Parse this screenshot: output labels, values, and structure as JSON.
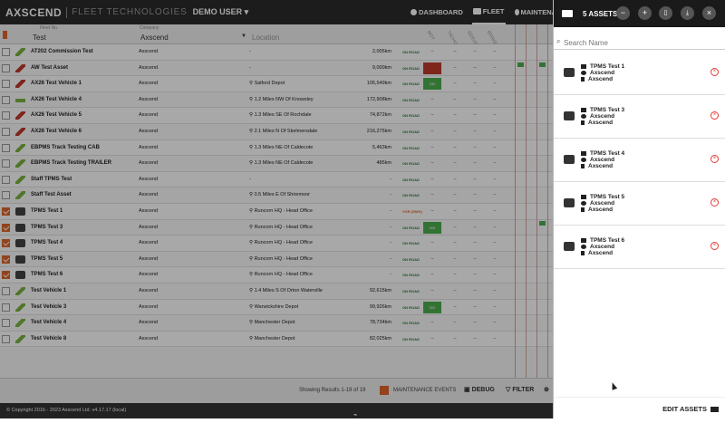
{
  "brand": {
    "logo": "AXSCEND",
    "sub": "FLEET TECHNOLOGIES",
    "user": "DEMO USER"
  },
  "nav": [
    {
      "label": "DASHBOARD",
      "icon": "dashboard-icon"
    },
    {
      "label": "FLEET",
      "icon": "truck-icon"
    },
    {
      "label": "MAINTENANCE",
      "icon": "wrench-icon"
    },
    {
      "label": "",
      "icon": "clock-icon"
    }
  ],
  "table": {
    "headers": {
      "fleet_no_label": "Fleet No.",
      "name": "Test",
      "company_label": "Company",
      "company": "Axscend",
      "location_placeholder": "Location",
      "cols": [
        "MOT",
        "TACHO",
        "SERVICE",
        "BRAKE"
      ]
    },
    "rows": [
      {
        "name": "AT202 Commission Test",
        "company": "Axscend",
        "location": "-",
        "km": "2,005km",
        "status": "ON ROAD",
        "icon": "stick",
        "chip": "",
        "checked": false
      },
      {
        "name": "AW Test Asset",
        "company": "Axscend",
        "location": "-",
        "km": "9,000km",
        "status": "ON ROAD",
        "icon": "red",
        "chip": "",
        "chipRed": true,
        "checked": false
      },
      {
        "name": "AX26 Test Vehicle 1",
        "company": "Axscend",
        "location": "Salford Depot",
        "km": "105,549km",
        "status": "ON ROAD",
        "icon": "red",
        "chip": "230",
        "checked": false
      },
      {
        "name": "AX26 Test Vehicle 4",
        "company": "Axscend",
        "location": "1.2 Miles NW Of Knowsley",
        "km": "172,908km",
        "status": "ON ROAD",
        "icon": "flat",
        "chip": "",
        "checked": false
      },
      {
        "name": "AX26 Test Vehicle 5",
        "company": "Axscend",
        "location": "1.3 Miles SE Of Rochdale",
        "km": "74,872km",
        "status": "ON ROAD",
        "icon": "red",
        "chip": "",
        "checked": false
      },
      {
        "name": "AX26 Test Vehicle 6",
        "company": "Axscend",
        "location": "2.1 Miles N Of Skelmersdale",
        "km": "216,275km",
        "status": "ON ROAD",
        "icon": "red",
        "chip": "",
        "checked": false
      },
      {
        "name": "EBPMS Track Testing CAB",
        "company": "Axscend",
        "location": "1.3 Miles NE Of Caldecote",
        "km": "5,463km",
        "status": "ON ROAD",
        "icon": "stick",
        "chip": "",
        "checked": false
      },
      {
        "name": "EBPMS Track Testing TRAILER",
        "company": "Axscend",
        "location": "1.3 Miles NE Of Caldecote",
        "km": "485km",
        "status": "ON ROAD",
        "icon": "stick",
        "chip": "",
        "checked": false
      },
      {
        "name": "Staff TPMS Test",
        "company": "Axscend",
        "location": "-",
        "km": "-",
        "status": "ON ROAD",
        "icon": "stick",
        "chip": "",
        "checked": false
      },
      {
        "name": "Staff Test Asset",
        "company": "Axscend",
        "location": "0.5 Miles E Of Shiremoor",
        "km": "-",
        "status": "ON ROAD",
        "icon": "stick",
        "chip": "",
        "checked": false
      },
      {
        "name": "TPMS Test 1",
        "company": "Axscend",
        "location": "Runcorn HQ - Head Office",
        "km": "-",
        "status": "VOR (DMG)",
        "warn": true,
        "icon": "truck",
        "chip": "",
        "checked": true
      },
      {
        "name": "TPMS Test 3",
        "company": "Axscend",
        "location": "Runcorn HQ - Head Office",
        "km": "-",
        "status": "ON ROAD",
        "icon": "truck",
        "chip": "305",
        "checked": true
      },
      {
        "name": "TPMS Test 4",
        "company": "Axscend",
        "location": "Runcorn HQ - Head Office",
        "km": "-",
        "status": "ON ROAD",
        "icon": "truck",
        "chip": "",
        "checked": true
      },
      {
        "name": "TPMS Test 5",
        "company": "Axscend",
        "location": "Runcorn HQ - Head Office",
        "km": "-",
        "status": "ON ROAD",
        "icon": "truck",
        "chip": "",
        "checked": true
      },
      {
        "name": "TPMS Test 6",
        "company": "Axscend",
        "location": "Runcorn HQ - Head Office",
        "km": "-",
        "status": "ON ROAD",
        "icon": "truck",
        "chip": "",
        "checked": true
      },
      {
        "name": "Test Vehicle 1",
        "company": "Axscend",
        "location": "1.4 Miles S Of Orton Waterville",
        "km": "92,615km",
        "status": "ON ROAD",
        "icon": "stick",
        "chip": "",
        "checked": false
      },
      {
        "name": "Test Vehicle 3",
        "company": "Axscend",
        "location": "Warwickshire Depot",
        "km": "99,926km",
        "status": "ON ROAD",
        "icon": "stick",
        "chip": "302",
        "checked": false
      },
      {
        "name": "Test Vehicle 4",
        "company": "Axscend",
        "location": "Manchester Depot",
        "km": "78,734km",
        "status": "ON ROAD",
        "icon": "stick",
        "chip": "",
        "checked": false
      },
      {
        "name": "Test Vehicle 8",
        "company": "Axscend",
        "location": "Manchester Depot",
        "km": "82,025km",
        "status": "ON ROAD",
        "icon": "stick",
        "chip": "",
        "checked": false
      }
    ]
  },
  "footer_bar": {
    "results": "Showing Results 1-19 of 19",
    "maint": "MAINTENANCE EVENTS",
    "debug": "DEBUG",
    "filter": "FILTER"
  },
  "copyright": "© Copyright 2016 - 2023 Axscend Ltd. v4.17.17 (local)",
  "panel": {
    "title": "5 ASSETS",
    "search_placeholder": "Search Name",
    "assets": [
      {
        "name": "TPMS Test 1",
        "company": "Axscend",
        "group": "Axscend"
      },
      {
        "name": "TPMS Test 3",
        "company": "Axscend",
        "group": "Axscend"
      },
      {
        "name": "TPMS Test 4",
        "company": "Axscend",
        "group": "Axscend"
      },
      {
        "name": "TPMS Test 5",
        "company": "Axscend",
        "group": "Axscend"
      },
      {
        "name": "TPMS Test 6",
        "company": "Axscend",
        "group": "Axscend"
      }
    ],
    "edit_label": "EDIT ASSETS"
  }
}
